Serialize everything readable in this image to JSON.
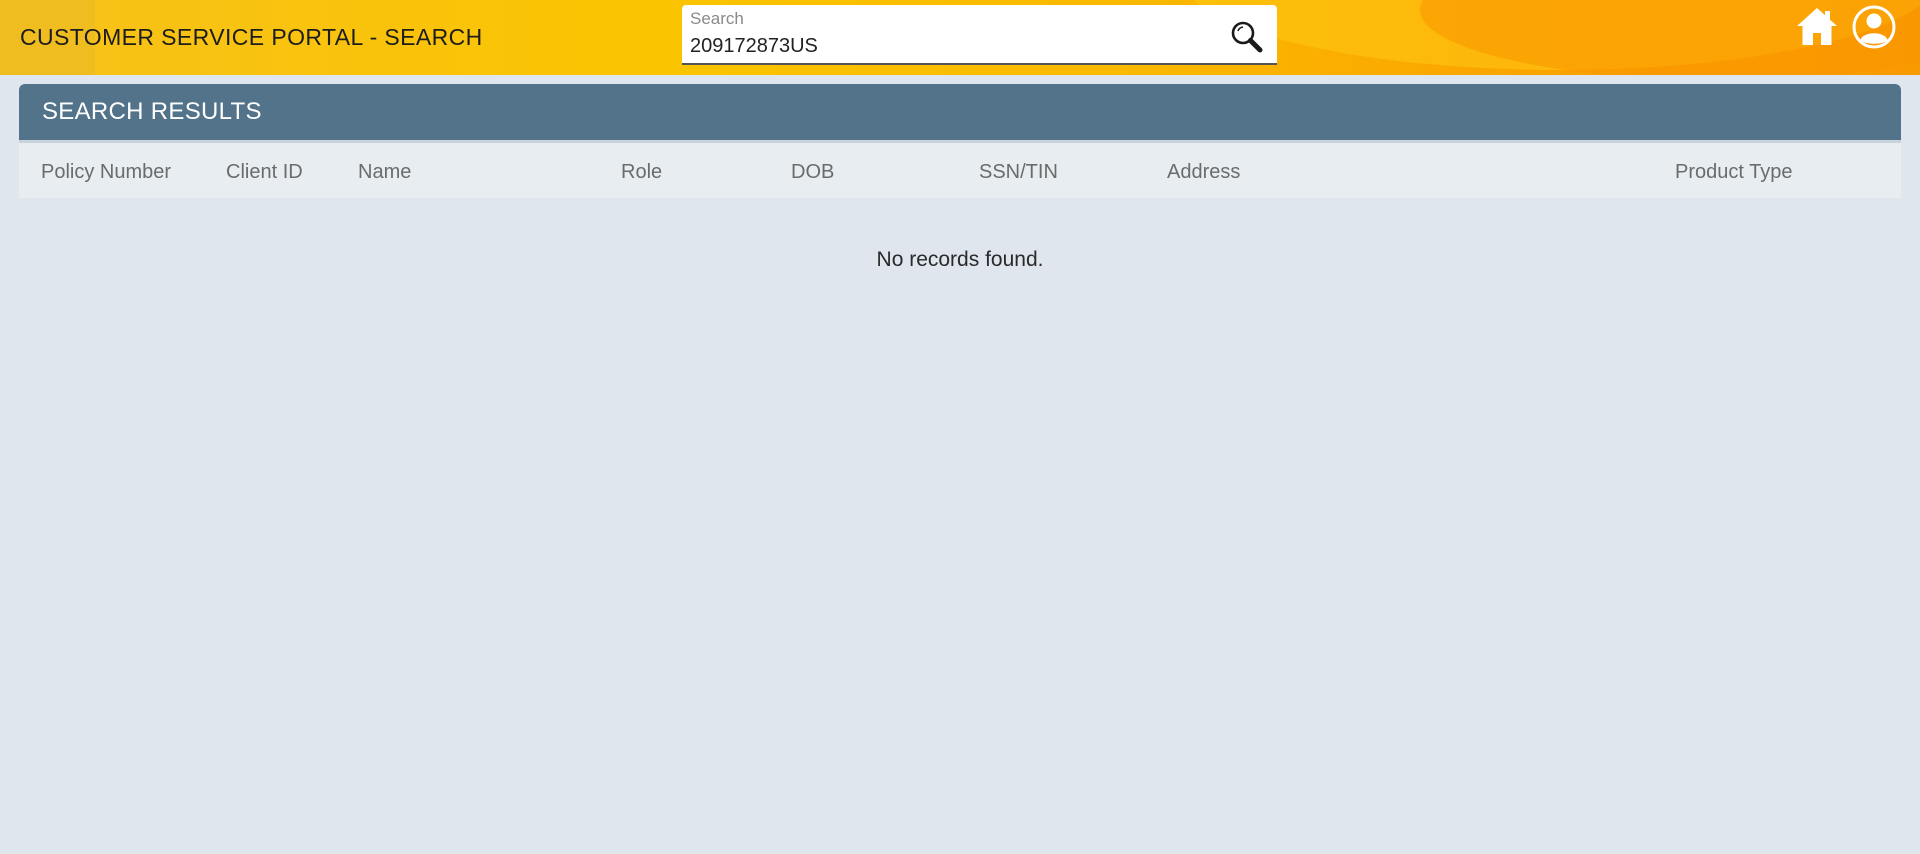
{
  "header": {
    "title": "CUSTOMER SERVICE PORTAL - SEARCH",
    "search": {
      "label": "Search",
      "value": "209172873US",
      "icon": "search-icon"
    },
    "icons": [
      "home-icon",
      "user-icon"
    ]
  },
  "results": {
    "title": "SEARCH RESULTS",
    "columns": [
      "Policy Number",
      "Client ID",
      "Name",
      "Role",
      "DOB",
      "SSN/TIN",
      "Address",
      "Product Type"
    ],
    "empty_message": "No records found."
  },
  "colors": {
    "header_gradient_start": "#fbc400",
    "header_gradient_end": "#f99a00",
    "panel_header": "#52738a",
    "background": "#dfe6ee"
  }
}
